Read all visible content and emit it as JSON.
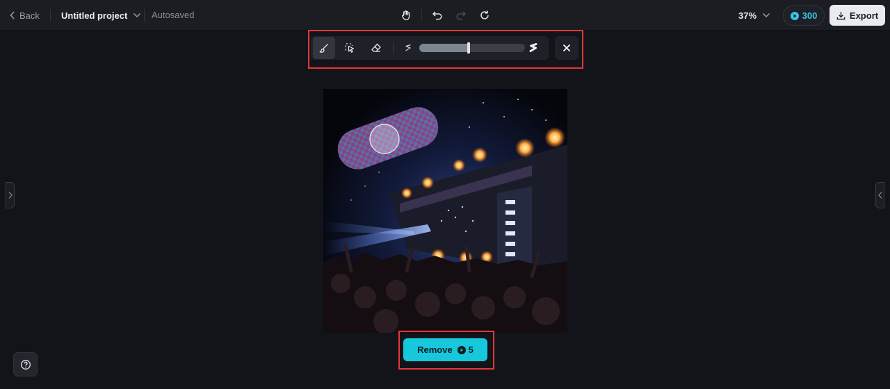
{
  "header": {
    "back_label": "Back",
    "project_name": "Untitled project",
    "autosaved_label": "Autosaved",
    "zoom": "37%",
    "credits": "300",
    "export_label": "Export"
  },
  "icons": {
    "back": "chevron-left-icon",
    "project_menu": "chevron-down-icon",
    "pan": "hand-icon",
    "undo": "undo-icon",
    "redo": "redo-icon",
    "reset": "refresh-icon",
    "zoom_menu": "chevron-down-icon",
    "credits": "credit-coin-icon",
    "export": "download-icon",
    "brush": "brush-icon",
    "lasso": "lasso-select-icon",
    "eraser": "eraser-icon",
    "brush_small": "brush-size-small-icon",
    "brush_large": "brush-size-large-icon",
    "close": "close-icon",
    "help": "help-icon"
  },
  "brush_toolbar": {
    "active_tool": "brush",
    "brush_size_fraction": 0.47
  },
  "remove_button": {
    "label": "Remove",
    "cost": "5"
  },
  "colors": {
    "accent": "#17c7dc",
    "highlight": "#e53935",
    "background": "#131419"
  }
}
